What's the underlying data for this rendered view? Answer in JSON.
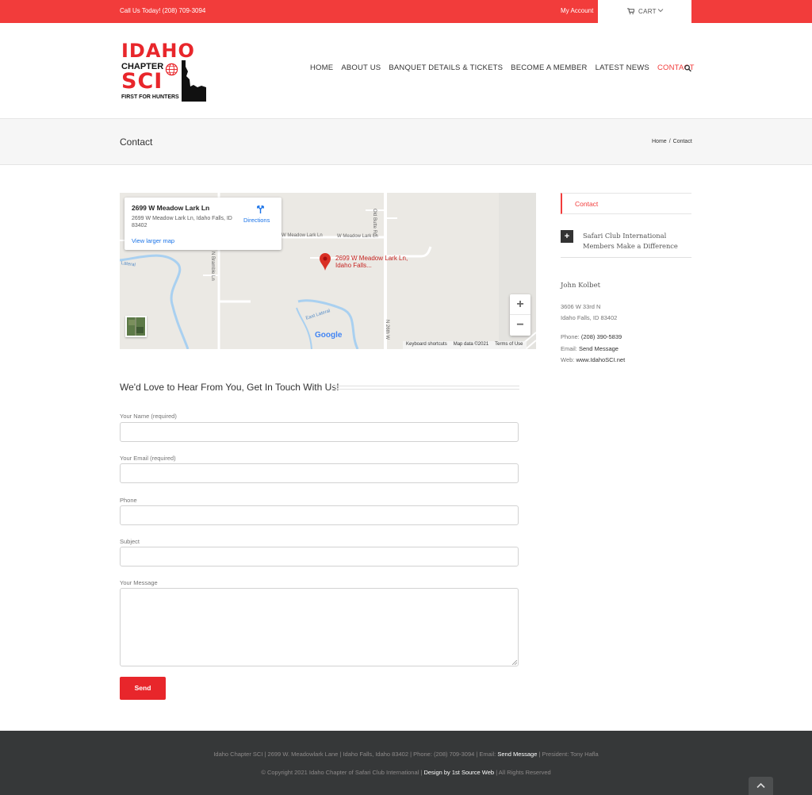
{
  "topbar": {
    "call_text": "Call Us Today! (208) 709-3094",
    "my_account": "My Account",
    "cart_label": "CART"
  },
  "logo": {
    "line1": "IDAHO",
    "line2": "CHAPTER",
    "line3": "SCI",
    "line4": "FIRST FOR HUNTERS"
  },
  "nav": {
    "items": [
      "HOME",
      "ABOUT US",
      "BANQUET DETAILS & TICKETS",
      "BECOME A MEMBER",
      "LATEST NEWS",
      "CONTACT"
    ],
    "active": "CONTACT"
  },
  "page": {
    "title": "Contact",
    "breadcrumb": [
      "Home",
      "Contact"
    ],
    "breadcrumb_sep": "/"
  },
  "map": {
    "card_title": "2699 W Meadow Lark Ln",
    "card_address": "2699 W Meadow Lark Ln, Idaho Falls, ID 83402",
    "directions": "Directions",
    "view_larger": "View larger map",
    "pin_label": "2699 W Meadow Lark Ln, Idaho Falls...",
    "roads": [
      "Old Butte Rd",
      "W Meadow Lark Ln",
      "W Meadow Lark Ln",
      "N Bramble Ln",
      "N 26th W",
      "East Lateral",
      "Lateral"
    ],
    "google": "Google",
    "attribution": [
      "Keyboard shortcuts",
      "Map data ©2021",
      "Terms of Use"
    ],
    "zoom_in": "+",
    "zoom_out": "−"
  },
  "form": {
    "heading": "We'd Love to Hear From You, Get In Touch With Us!",
    "name_label": "Your Name (required)",
    "email_label": "Your Email (required)",
    "phone_label": "Phone",
    "subject_label": "Subject",
    "message_label": "Your Message",
    "send": "Send"
  },
  "sidebar": {
    "tab": "Contact",
    "accordion_title": "Safari Club International Members Make a Difference",
    "contact_name": "John Kolbet",
    "address1": "3606 W 33rd N",
    "address2": "Idaho Falls, ID 83402",
    "phone_label": "Phone:",
    "phone_value": "(208) 390-5839",
    "email_label": "Email:",
    "email_value": "Send Message",
    "web_label": "Web:",
    "web_value": "www.IdahoSCI.net"
  },
  "footer": {
    "line1_before": "Idaho Chapter SCI | 2699 W. Meadowlark Lane | Idaho Falls, Idaho 83402 | Phone: (208) 709-3094 | Email:",
    "line1_link": "Send Message",
    "line1_after": "| President: Tony Hafla",
    "line2_before": "© Copyright 2021 Idaho Chapter of Safari Club International |",
    "line2_link": "Design by 1st Source Web",
    "line2_after": "| All Rights Reserved"
  },
  "colors": {
    "accent": "#f23c3b",
    "footer_bg": "#363839",
    "send_button": "#e8262b"
  },
  "icons": [
    "cart-icon",
    "chevron-down-icon",
    "search-icon",
    "globe-icon",
    "idaho-state-icon",
    "directions-icon",
    "map-pin-icon",
    "plus-icon",
    "resize-grip-icon",
    "chevron-up-icon"
  ]
}
